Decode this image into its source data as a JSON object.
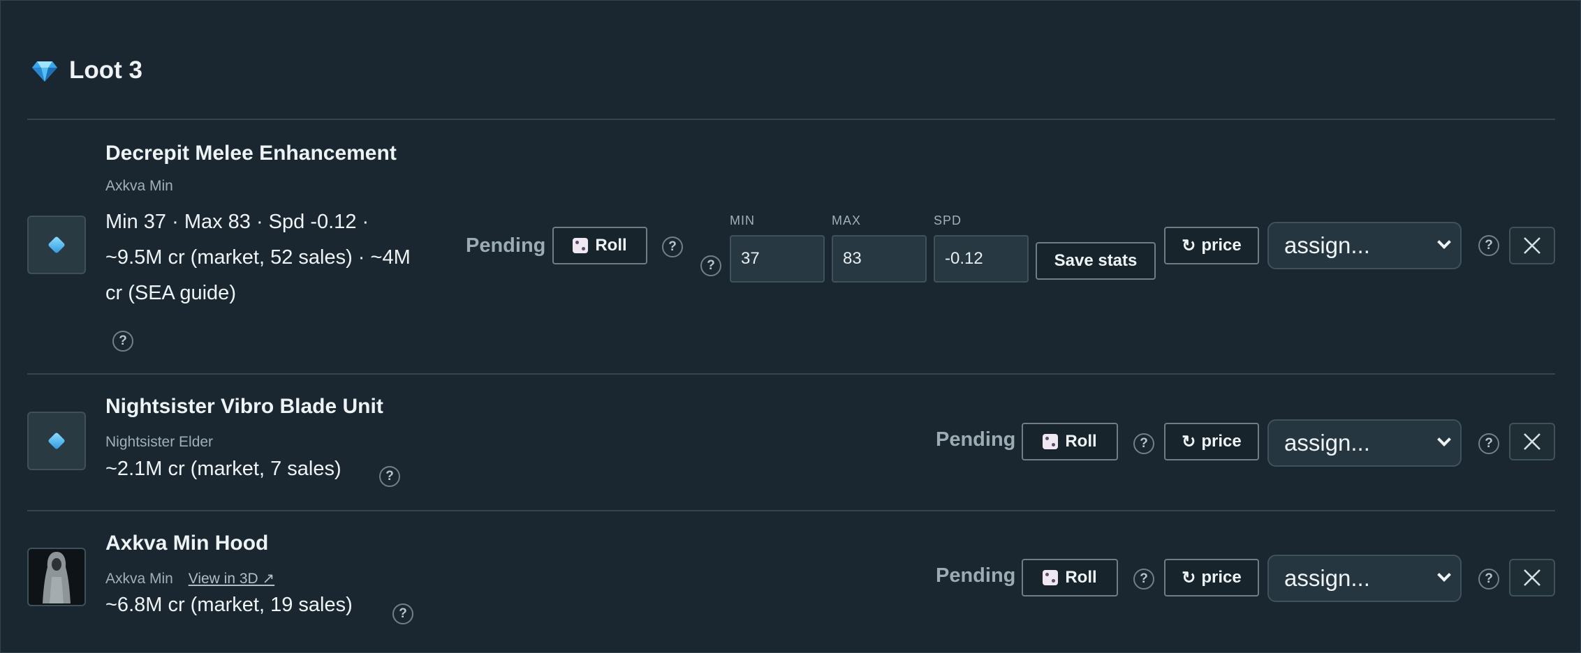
{
  "header": {
    "icon": "gem-icon",
    "title": "Loot 3"
  },
  "common": {
    "status": "Pending",
    "roll_label": "Roll",
    "price_label": "price",
    "price_icon": "↻",
    "assign_placeholder": "assign...",
    "help_glyph": "?"
  },
  "items": [
    {
      "name": "Decrepit Melee Enhancement",
      "source": "Axkva Min",
      "desc_line1": "Min 37 · Max 83 · Spd -0.12 ·",
      "desc_line2": "~9.5M cr (market, 52 sales) · ~4M",
      "desc_line3": "cr (SEA guide)",
      "stats": {
        "min_label": "MIN",
        "max_label": "MAX",
        "spd_label": "SPD",
        "min": "37",
        "max": "83",
        "spd": "-0.12",
        "save_label": "Save stats"
      }
    },
    {
      "name": "Nightsister Vibro Blade Unit",
      "source": "Nightsister Elder",
      "desc": "~2.1M cr (market, 7 sales)"
    },
    {
      "name": "Axkva Min Hood",
      "source": "Axkva Min",
      "link": "View in 3D ↗",
      "desc": "~6.8M cr (market, 19 sales)"
    }
  ]
}
